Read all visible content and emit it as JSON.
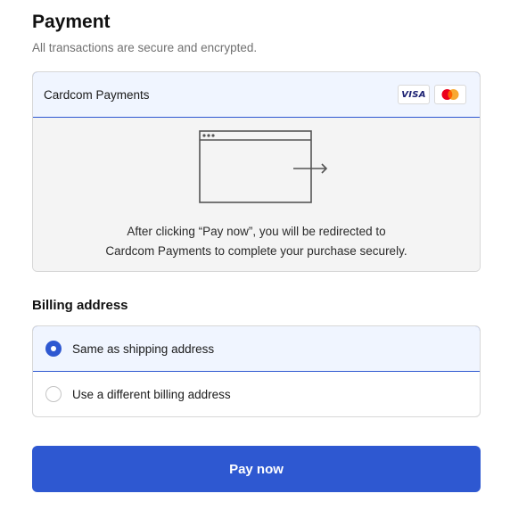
{
  "payment": {
    "title": "Payment",
    "subtitle": "All transactions are secure and encrypted.",
    "gateway": {
      "label": "Cardcom Payments",
      "cards": [
        {
          "name": "visa-icon",
          "text": "VISA"
        },
        {
          "name": "mastercard-icon"
        }
      ]
    },
    "redirect_line1": "After clicking “Pay now”, you will be redirected to",
    "redirect_line2": "Cardcom Payments to complete your purchase securely."
  },
  "billing": {
    "title": "Billing address",
    "options": [
      {
        "label": "Same as shipping address",
        "selected": true
      },
      {
        "label": "Use a different billing address",
        "selected": false
      }
    ]
  },
  "pay_button": {
    "label": "Pay now"
  },
  "colors": {
    "accent": "#2e58d1",
    "selected_bg": "#f0f5ff",
    "panel_bg": "#f4f4f4",
    "mastercard_red": "#eb001b",
    "mastercard_orange": "#f79e1b"
  }
}
